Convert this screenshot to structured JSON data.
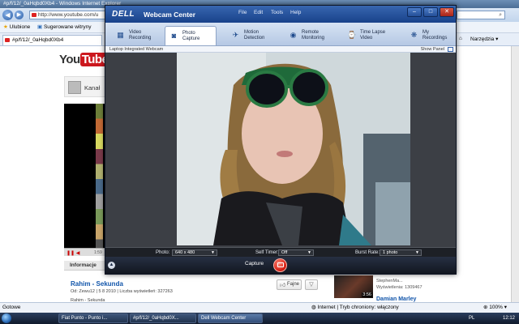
{
  "ie": {
    "window_title": "#p/f/12/_0aHqbd0Xb4 - Windows Internet Explorer",
    "address": "http://www.youtube.com/u",
    "favorites_label": "Ulubione",
    "suggested_sites": "Sugerowane witryny",
    "tab_title": "#p/f/12/_0aHqbd0Xb4",
    "tools_label": "Narzędzia",
    "status_left": "Gotowe",
    "status_zone": "Internet | Tryb chroniony: włączony",
    "zoom": "100%"
  },
  "youtube": {
    "logo_you": "You",
    "logo_tube": "Tube",
    "channel_label": "Kanał",
    "player_time": "1:59",
    "info_tab": "Informacje",
    "video_title": "Rahim - Sekunda",
    "video_meta": "Od: Zewu12 | 5 8 2010 | Liczba wyświetleń: 327263",
    "video_desc": "Rahim - Sekunda",
    "like_label": "Fajne",
    "side_duration": "3:56",
    "side_channel": "StephenMa...",
    "side_views": "Wyświetlenia: 1309467",
    "side_next_title": "Damian Marley"
  },
  "webcam": {
    "brand": "DELL",
    "app_title": "Webcam Center",
    "menu": [
      "File",
      "Edit",
      "Tools",
      "Help"
    ],
    "tabs": [
      {
        "label": "Video\nRecording",
        "icon": "video-camera-icon",
        "glyph": "▦"
      },
      {
        "label": "Photo\nCapture",
        "icon": "camera-icon",
        "glyph": "◙",
        "active": true
      },
      {
        "label": "Motion\nDetection",
        "icon": "running-figure-icon",
        "glyph": "✈"
      },
      {
        "label": "Remote\nMonitoring",
        "icon": "globe-icon",
        "glyph": "◉"
      },
      {
        "label": "Time Lapse\nVideo",
        "icon": "stopwatch-icon",
        "glyph": "⌚"
      },
      {
        "label": "My\nRecordings",
        "icon": "film-reel-icon",
        "glyph": "❋"
      }
    ],
    "source_label": "Laptop Integrated Webcam",
    "show_panel": "Show Panel",
    "settings": {
      "photo_label": "Photo:",
      "photo_value": "640 x 480",
      "timer_label": "Self Timer:",
      "timer_value": "Off",
      "burst_label": "Burst Rate:",
      "burst_value": "1 photo"
    },
    "capture_label": "Capture"
  },
  "taskbar": {
    "items": [
      "Fiat Punto - Punto i...",
      "#p/f/12/_0aHqbd0X...",
      "Dell Webcam Center"
    ],
    "lang": "PL",
    "clock": "12:12"
  }
}
